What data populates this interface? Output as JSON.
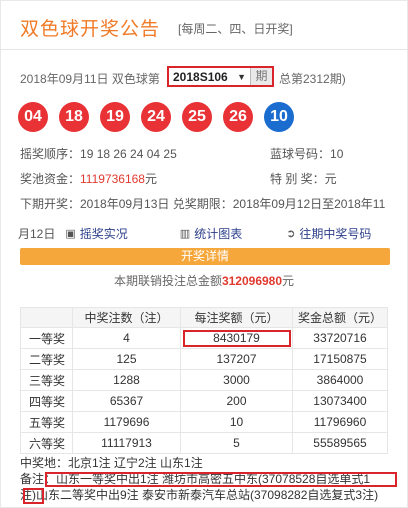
{
  "header": {
    "title": "双色球开奖公告",
    "subtitle": "[每周二、四、日开奖]"
  },
  "draw": {
    "date_text": "2018年09月11日 双色球第",
    "issue_selected": "2018S106",
    "period_label": "期",
    "total_text": "总第2312期)"
  },
  "balls": {
    "red": [
      "04",
      "18",
      "19",
      "24",
      "25",
      "26"
    ],
    "blue": "10",
    "red_color": "#e83236",
    "blue_color": "#1a6ccf"
  },
  "info": {
    "order_label": "摇奖顺序：",
    "order_value": "19 18 26 24 04 25",
    "blue_label": "蓝球号码：",
    "blue_value": "10",
    "pool_label": "奖池资金：",
    "pool_value": "1119736168",
    "pool_unit": "元",
    "special_label": "特 别 奖：",
    "special_value": "元",
    "next_text": "下期开奖：2018年09月13日 兑奖期限：2018年09月12日至2018年11",
    "next_text2": "月12日"
  },
  "tools": {
    "video": "摇奖实况",
    "chart": "统计图表",
    "history": "往期中奖号码"
  },
  "bar_label": "开奖详情",
  "sales": {
    "prefix": "本期联销投注总金额",
    "value": "312096980",
    "unit": "元"
  },
  "table": {
    "headers": [
      "",
      "中奖注数（注）",
      "每注奖额（元）",
      "奖金总额（元）"
    ],
    "rows": [
      {
        "level": "一等奖",
        "count": "4",
        "each": "8430179",
        "total": "33720716"
      },
      {
        "level": "二等奖",
        "count": "125",
        "each": "137207",
        "total": "17150875"
      },
      {
        "level": "三等奖",
        "count": "1288",
        "each": "3000",
        "total": "3864000"
      },
      {
        "level": "四等奖",
        "count": "65367",
        "each": "200",
        "total": "13073400"
      },
      {
        "level": "五等奖",
        "count": "1179696",
        "each": "10",
        "total": "11796960"
      },
      {
        "level": "六等奖",
        "count": "11117913",
        "each": "5",
        "total": "55589565"
      }
    ]
  },
  "notes": {
    "area": "中奖地：北京1注 辽宁2注 山东1注",
    "remark": "备注：山东一等奖中出1注 潍坊市高密五中东(37078528自选单式1",
    "remark2": "注)山东二等奖中出9注 泰安市新泰汽车总站(37098282自选复式3注)"
  }
}
